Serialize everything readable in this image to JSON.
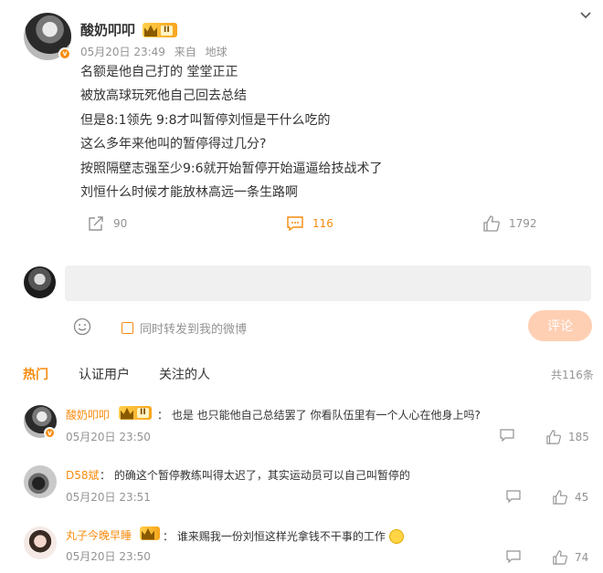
{
  "post": {
    "author": "酸奶叩叩",
    "level": "II",
    "date": "05月20日 23:49",
    "source_label": "来自",
    "source": "地球",
    "lines": [
      "名额是他自己打的 堂堂正正",
      "被放高球玩死他自己回去总结",
      "但是8:1领先 9:8才叫暂停刘恒是干什么吃的",
      "这么多年来他叫的暂停得过几分?",
      "按照隔壁志强至少9:6就开始暂停开始逼逼给技战术了",
      "刘恒什么时候才能放林高远一条生路啊"
    ],
    "reposts": "90",
    "comments": "116",
    "likes": "1792"
  },
  "composer": {
    "input_value": "",
    "repost_label": "同时转发到我的微博",
    "submit_label": "评论"
  },
  "tabs": [
    "热门",
    "认证用户",
    "关注的人"
  ],
  "total_comments": "共116条",
  "comments": [
    {
      "name": "酸奶叩叩",
      "level": "II",
      "text": "也是 也只能他自己总结罢了 你看队伍里有一个人心在他身上吗?",
      "time": "05月20日 23:50",
      "likes": "185"
    },
    {
      "name": "D58斌",
      "text": "的确这个暂停教练叫得太迟了，其实运动员可以自己叫暂停的",
      "time": "05月20日 23:51",
      "likes": "45"
    },
    {
      "name": "丸子今晚早睡",
      "text": "谁来赐我一份刘恒这样光拿钱不干事的工作",
      "time": "05月20日 23:50",
      "likes": "74"
    }
  ],
  "colors": {
    "accent": "#f78c0f",
    "muted": "#939393",
    "text": "#333333",
    "submit_bg": "#ffcfb3"
  },
  "icons": [
    "chevron-down-icon",
    "repost-icon",
    "comment-icon",
    "like-icon",
    "emoji-icon",
    "verified-icon",
    "level-crown-icon",
    "reply-icon",
    "smiley-emoji"
  ]
}
